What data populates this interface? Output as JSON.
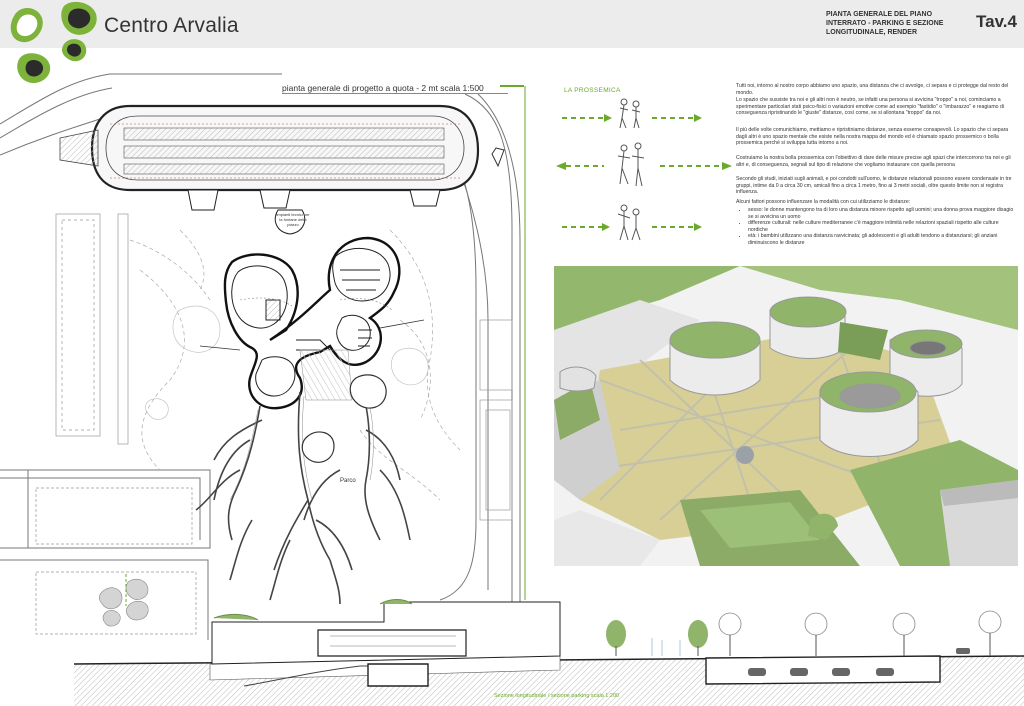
{
  "header": {
    "title": "Centro Arvalia",
    "plate_description": "PIANTA GENERALE DEL PIANO INTERRATO - PARKING E SEZIONE LONGITUDINALE, RENDER",
    "plate_number": "Tav.4"
  },
  "plan": {
    "caption": "pianta generale di progetto a quota - 2 mt   scala 1:500",
    "label_parco": "Parco",
    "label_impianti": "Impianti tecnici per la fontane dello piazzo"
  },
  "prossemica": {
    "title": "LA PROSSEMICA"
  },
  "text": {
    "p1": "Tutti noi, intorno al nostro corpo abbiamo uno spazio, una distanza che ci avvolge, ci separa e ci protegge dal resto del mondo.",
    "p2": "Lo spazio che sussiste tra noi e gli altri non è neutro, se infatti una persona si avvicina \"troppo\" a noi, cominciamo a sperimentare particolari stati psico-fisici o variazioni emotive come ad esempio \"fastidio\" o \"imbarazzo\" e reagiamo di conseguenza ripristinando le \"giuste\" distanze, così come, se si allontana \"troppo\" da noi.",
    "p3": "Il più delle volte comunichiamo, mettiamo e ripristiniamo distanze, senza esserne consapevoli. Lo spazio che ci separa dagli altri è uno spazio mentale che esiste nella nostra mappa del mondo ed è chiamato spazio prossemico o bolla prossemica perché si sviluppa tutta intorno a noi.",
    "p4": "Costruiamo la nostra bolla prossemica con l'obiettivo di dare delle misure precise agli spazi che intercorrono tra noi e gli altri e, di conseguenza, segnali sul tipo di relazione che vogliamo instaurare con quella persona",
    "p5": "Secondo gli studi, iniziati sugli animali, e poi condotti sull'uomo, le distanze relazionali possono essere condensate in tre gruppi, intime da 0 a circa 30 cm, amicali fino a circa 1 metro, fino ai 3 metri sociali, oltre questo limite non si registra influenza.",
    "p6": "Alcuni fattori possono influenzare la modalità con cui utilizziamo le distanze:",
    "bullets": [
      "sesso: le donne mantengono tra di loro una distanza minore rispetto agli uomini; una donna prova maggiore disagio se si avvicina un uomo",
      "differenze culturali: nelle culture mediterranee c'è maggiore intimità nelle relazioni spaziali rispetto alle culture nordiche",
      "età: i bambini utilizzano una distanza ravvicinata; gli adolescenti e gli adulti tendono a distanziarsi; gli anziani diminuiscono le distanze"
    ]
  },
  "section": {
    "caption": "Sezione longitudinale  /  sezione parking   scala 1:200"
  },
  "colors": {
    "accent_green": "#6aaa2a",
    "roof_green": "#8fb46a",
    "plaza_ochre": "#d8cf96",
    "ground_hatch": "#cfcfcf"
  }
}
